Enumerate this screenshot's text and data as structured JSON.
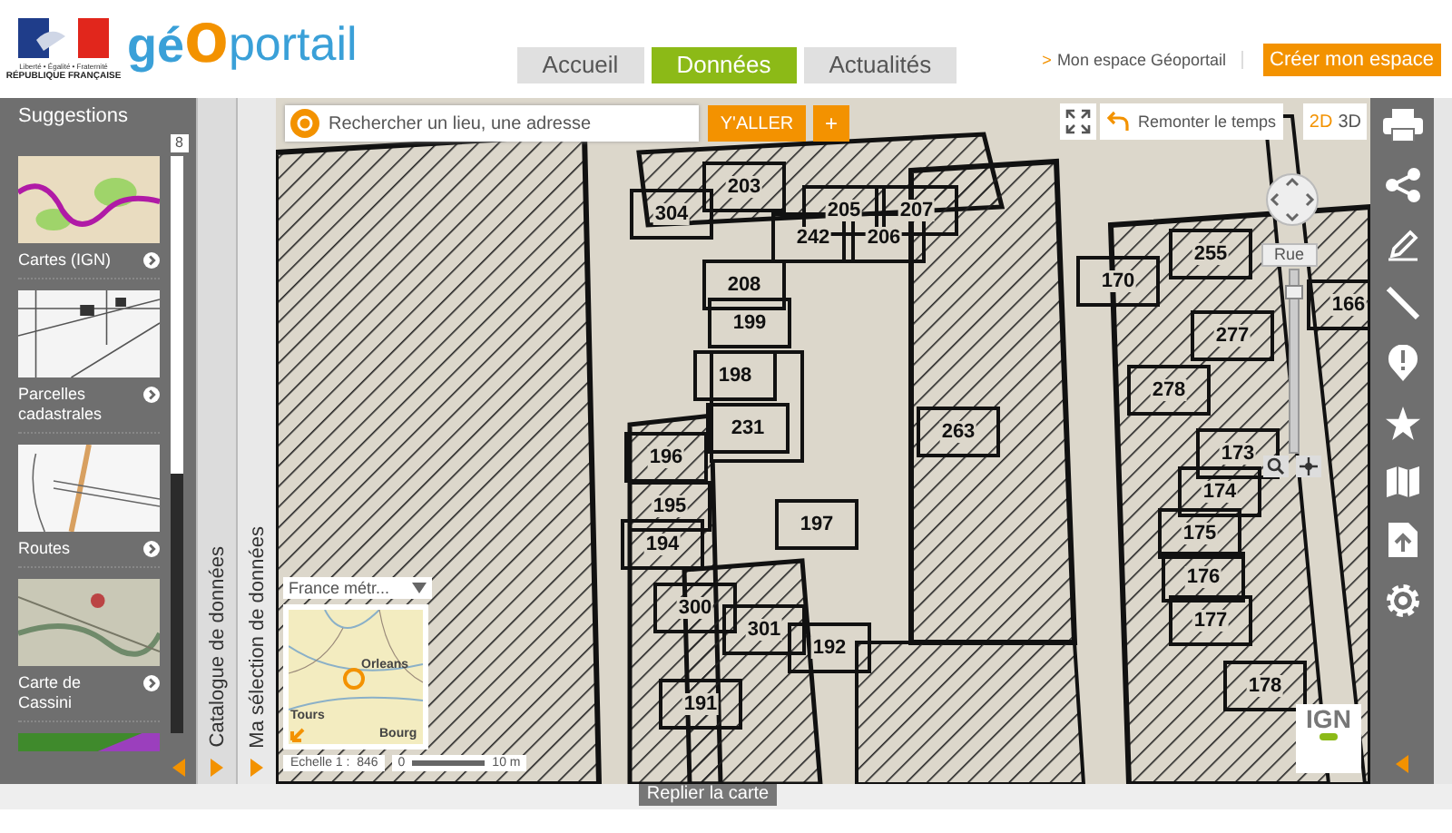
{
  "header": {
    "republic": {
      "motto": "Liberté • Égalité • Fraternité",
      "name": "RÉPUBLIQUE FRANÇAISE"
    },
    "logo": [
      "gé",
      "o",
      "portail"
    ],
    "nav": [
      {
        "label": "Accueil",
        "selected": false
      },
      {
        "label": "Données",
        "selected": true
      },
      {
        "label": "Actualités",
        "selected": false
      }
    ],
    "account_link": {
      "marker": ">",
      "label": "Mon espace Géoportail"
    },
    "create_button": "Créer mon espace"
  },
  "sidebar": {
    "title": "Suggestions",
    "count": "8",
    "items": [
      {
        "label": "Cartes (IGN)",
        "kind": "topo"
      },
      {
        "label": "Parcelles cadastrales",
        "kind": "cadastre"
      },
      {
        "label": "Routes",
        "kind": "roads"
      },
      {
        "label": "Carte de Cassini",
        "kind": "cassini"
      },
      {
        "kind": "geology"
      }
    ],
    "panels": [
      "Catalogue de données",
      "Ma sélection de données"
    ]
  },
  "map": {
    "search": {
      "placeholder": "Rechercher un lieu, une adresse"
    },
    "go_button": "Y'ALLER",
    "plus_button": "+",
    "time_button": "Remonter le temps",
    "view_modes": [
      {
        "label": "2D",
        "selected": true
      },
      {
        "label": "3D",
        "selected": false
      }
    ],
    "street_label": "Rue",
    "zoom": {
      "level": 0.92
    },
    "parcels": [
      "304",
      "203",
      "205",
      "207",
      "242",
      "206",
      "208",
      "199",
      "198",
      "231",
      "263",
      "196",
      "195",
      "194",
      "197",
      "300",
      "301",
      "192",
      "191",
      "255",
      "170",
      "166",
      "277",
      "278",
      "173",
      "174",
      "175",
      "176",
      "177",
      "178"
    ],
    "overview": {
      "region": "France métr...",
      "places": [
        "Orleans",
        "Tours",
        "Bourg"
      ],
      "scale": "Echelle 1 :  846",
      "scale_bar": {
        "start": "0",
        "end": "10 m"
      }
    },
    "attribution": "IGN"
  },
  "collapse_tab": "Replier la carte"
}
